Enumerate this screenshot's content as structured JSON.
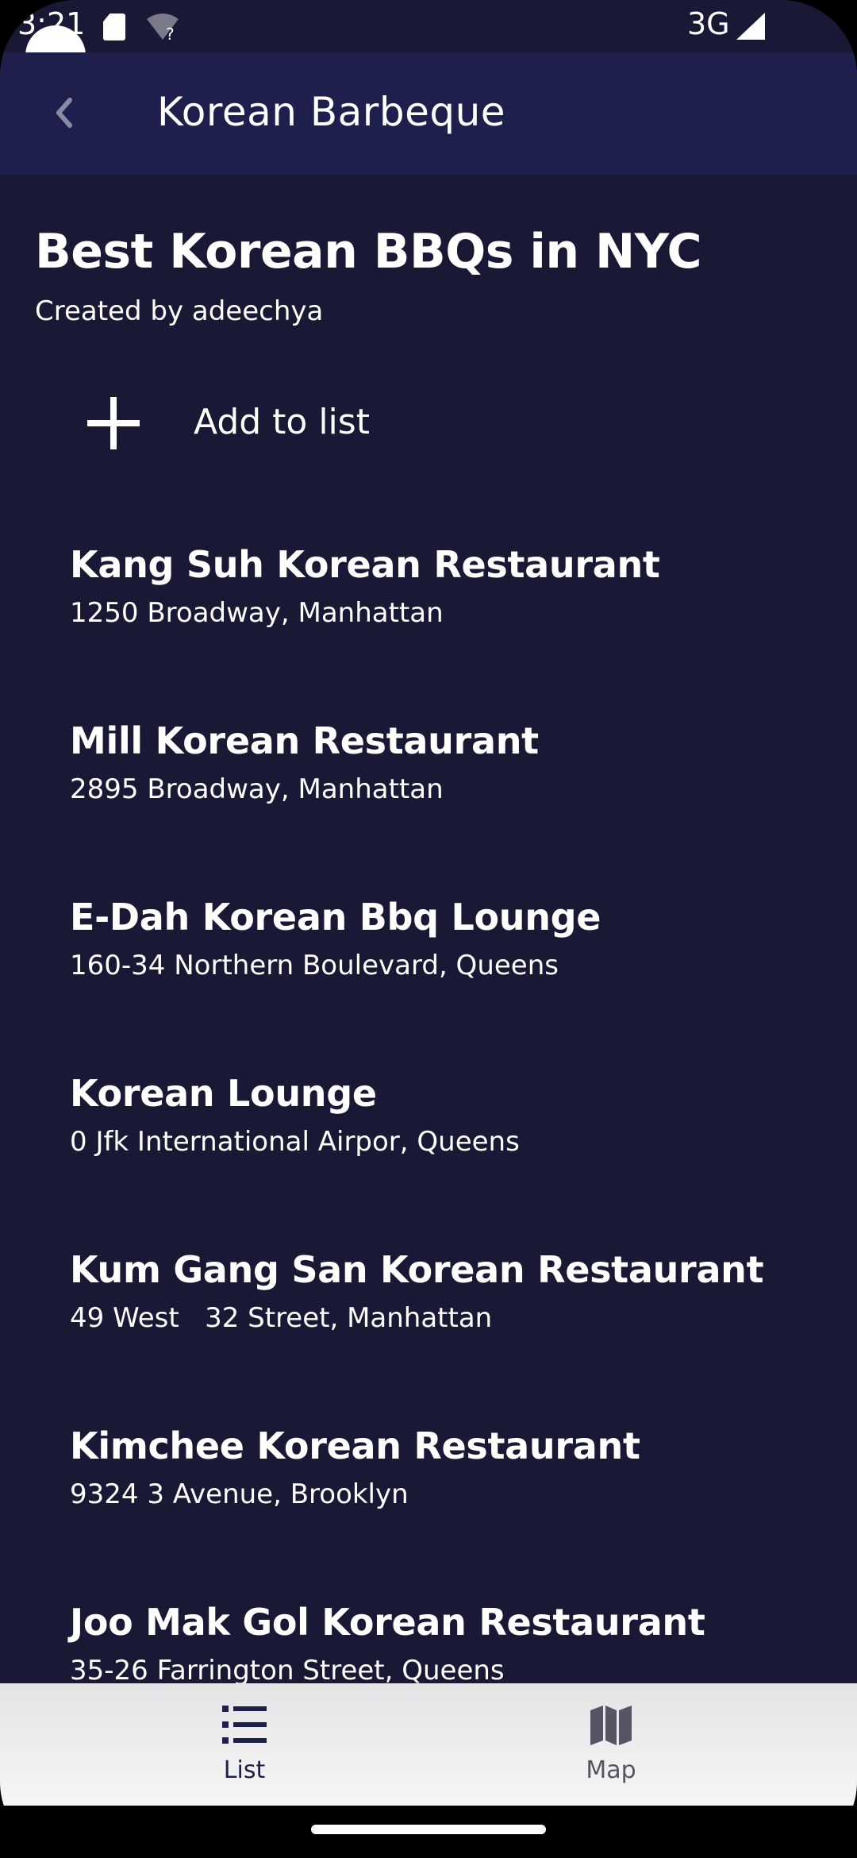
{
  "status_bar": {
    "time": "3:21",
    "network": "3G"
  },
  "app_bar": {
    "back_icon": "chevron-left",
    "title": "Korean Barbeque"
  },
  "list": {
    "heading": "Best Korean BBQs in NYC",
    "creator": "Created by adeechya",
    "add_label": "Add to list",
    "restaurants": [
      {
        "name": "Kang Suh Korean Restaurant",
        "address": "1250 Broadway, Manhattan"
      },
      {
        "name": "Mill Korean Restaurant",
        "address": "2895 Broadway, Manhattan"
      },
      {
        "name": "E-Dah Korean Bbq Lounge",
        "address": "160-34 Northern Boulevard, Queens"
      },
      {
        "name": "Korean Lounge",
        "address": "0 Jfk International Airpor, Queens"
      },
      {
        "name": "Kum Gang San Korean Restaurant",
        "address": "49 West   32 Street, Manhattan"
      },
      {
        "name": "Kimchee Korean Restaurant",
        "address": "9324 3 Avenue, Brooklyn"
      },
      {
        "name": "Joo Mak Gol Korean Restaurant",
        "address": "35-26 Farrington Street, Queens"
      }
    ]
  },
  "bottom_nav": {
    "tabs": [
      {
        "label": "List",
        "icon": "list-icon",
        "selected": true
      },
      {
        "label": "Map",
        "icon": "map-icon",
        "selected": false
      }
    ]
  },
  "colors": {
    "background": "#191935",
    "app_bar": "#1f1f4d",
    "text": "#ffffff",
    "nav_background": "#f0f0f0",
    "nav_selected": "#1f1f4d",
    "nav_unselected": "#555566"
  }
}
